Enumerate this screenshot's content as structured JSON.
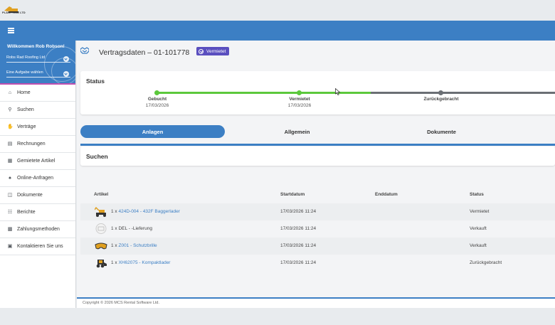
{
  "brand": {
    "logo_text": "PLANT HIRE LTD"
  },
  "sidebar": {
    "welcome": "Willkommen Rob Robson!",
    "company_select": "Robs Rad Roofing Ltd",
    "task_select": "Eine Aufgabe wählen",
    "items": [
      {
        "label": "Home",
        "icon": "home-icon"
      },
      {
        "label": "Suchen",
        "icon": "search-icon"
      },
      {
        "label": "Verträge",
        "icon": "handshake-icon"
      },
      {
        "label": "Rechnungen",
        "icon": "invoice-icon"
      },
      {
        "label": "Gemietete Artikel",
        "icon": "list-icon"
      },
      {
        "label": "Online-Anfragen",
        "icon": "bell-icon"
      },
      {
        "label": "Dokumente",
        "icon": "documents-icon"
      },
      {
        "label": "Berichte",
        "icon": "report-icon"
      },
      {
        "label": "Zahlungsmethoden",
        "icon": "credit-card-icon"
      },
      {
        "label": "Kontaktieren Sie uns",
        "icon": "contact-card-icon"
      }
    ]
  },
  "header": {
    "title": "Vertragsdaten – 01-101778",
    "status_badge": "Vermietet"
  },
  "status_card": {
    "title": "Status",
    "steps": [
      {
        "label": "Gebucht",
        "date": "17/03/2026"
      },
      {
        "label": "Vermietet",
        "date": "17/03/2026"
      },
      {
        "label": "Zurückgebracht",
        "date": ""
      }
    ],
    "colors": {
      "done": "#5cc83c",
      "pending": "#6b6f74"
    }
  },
  "tabs": [
    {
      "label": "Anlagen",
      "active": true
    },
    {
      "label": "Allgemein",
      "active": false
    },
    {
      "label": "Dokumente",
      "active": false
    }
  ],
  "search": {
    "title": "Suchen"
  },
  "table": {
    "headers": [
      "Artikel",
      "Startdatum",
      "Enddatum",
      "Status"
    ],
    "rows": [
      {
        "qty": "1 x",
        "article": "424D-004 - 432F Baggerlader",
        "start": "17/03/2026 11:24",
        "end": "",
        "status": "Vermietet",
        "thumb": "excavator-icon"
      },
      {
        "qty": "1 x",
        "article": "DEL - -Lieferung",
        "start": "17/03/2026 11:24",
        "end": "",
        "status": "Verkauft",
        "thumb": "no-image-icon"
      },
      {
        "qty": "1 x",
        "article": "Z001 - Schutzbrille",
        "start": "17/03/2026 11:24",
        "end": "",
        "status": "Verkauft",
        "thumb": "goggles-icon"
      },
      {
        "qty": "1 x",
        "article": "XH62075 - Kompaktlader",
        "start": "17/03/2026 11:24",
        "end": "",
        "status": "Zurückgebracht",
        "thumb": "skid-steer-icon"
      }
    ]
  },
  "footer": {
    "copyright": "Copyright © 2026 MCS Rental Software Ltd."
  },
  "theme": {
    "primary": "#3c7fc4",
    "badge": "#5a4fbf"
  }
}
